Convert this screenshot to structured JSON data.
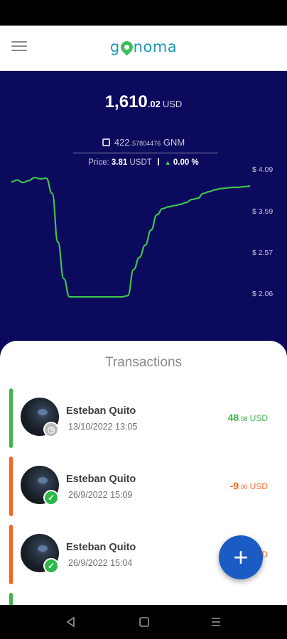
{
  "app": {
    "logo_left": "g",
    "logo_right": "noma"
  },
  "balance": {
    "integer": "1,610",
    "decimals": ".02",
    "currency": "USD"
  },
  "token": {
    "amount_int": "422.",
    "amount_dec": "57804476",
    "symbol": "GNM"
  },
  "price": {
    "label": "Price:",
    "value": "3.81",
    "unit": "USDT",
    "change": "0.00 %"
  },
  "chart_data": {
    "type": "line",
    "y_ticks": [
      "$ 4.09",
      "$ 3.59",
      "$ 2.57",
      "$ 2.06"
    ],
    "ylim": [
      2.06,
      4.09
    ],
    "series": [
      {
        "values": [
          3.89,
          3.92,
          3.88,
          3.91,
          3.96,
          3.94,
          3.95,
          3.7,
          2.9,
          2.3,
          2.0,
          2.0,
          2.0,
          2.0,
          2.0,
          2.0,
          2.0,
          2.0,
          2.0,
          2.0,
          2.02,
          2.45,
          2.65,
          2.85,
          3.1,
          3.35,
          3.45,
          3.48,
          3.5,
          3.52,
          3.55,
          3.6,
          3.62,
          3.7,
          3.73,
          3.76,
          3.78,
          3.79,
          3.8,
          3.8,
          3.81,
          3.82
        ]
      }
    ],
    "line_color": "#3fc24f",
    "grid": false
  },
  "transactions": {
    "title": "Transactions",
    "items": [
      {
        "name": "Esteban Quito",
        "date": "13/10/2022 13:05",
        "amount_int": "48",
        "amount_dec": ".08",
        "currency": "USD",
        "color": "#3fb54a",
        "badge": "clock-icon",
        "badge_color": "#b8b8b8"
      },
      {
        "name": "Esteban Quito",
        "date": "26/9/2022 15:09",
        "amount_int": "-9",
        "amount_dec": ".00",
        "currency": "USD",
        "color": "#f26522",
        "badge": "check-icon",
        "badge_color": "#2db84a"
      },
      {
        "name": "Esteban Quito",
        "date": "26/9/2022 15:04",
        "amount_int": "",
        "amount_dec": "",
        "currency": "D",
        "color": "#f26522",
        "badge": "check-icon",
        "badge_color": "#2db84a"
      }
    ]
  },
  "fab": {
    "label": "+"
  },
  "colors": {
    "hero_bg": "#0c0a5c",
    "accent": "#1a5cc4",
    "positive": "#3fb54a",
    "negative": "#f26522"
  }
}
